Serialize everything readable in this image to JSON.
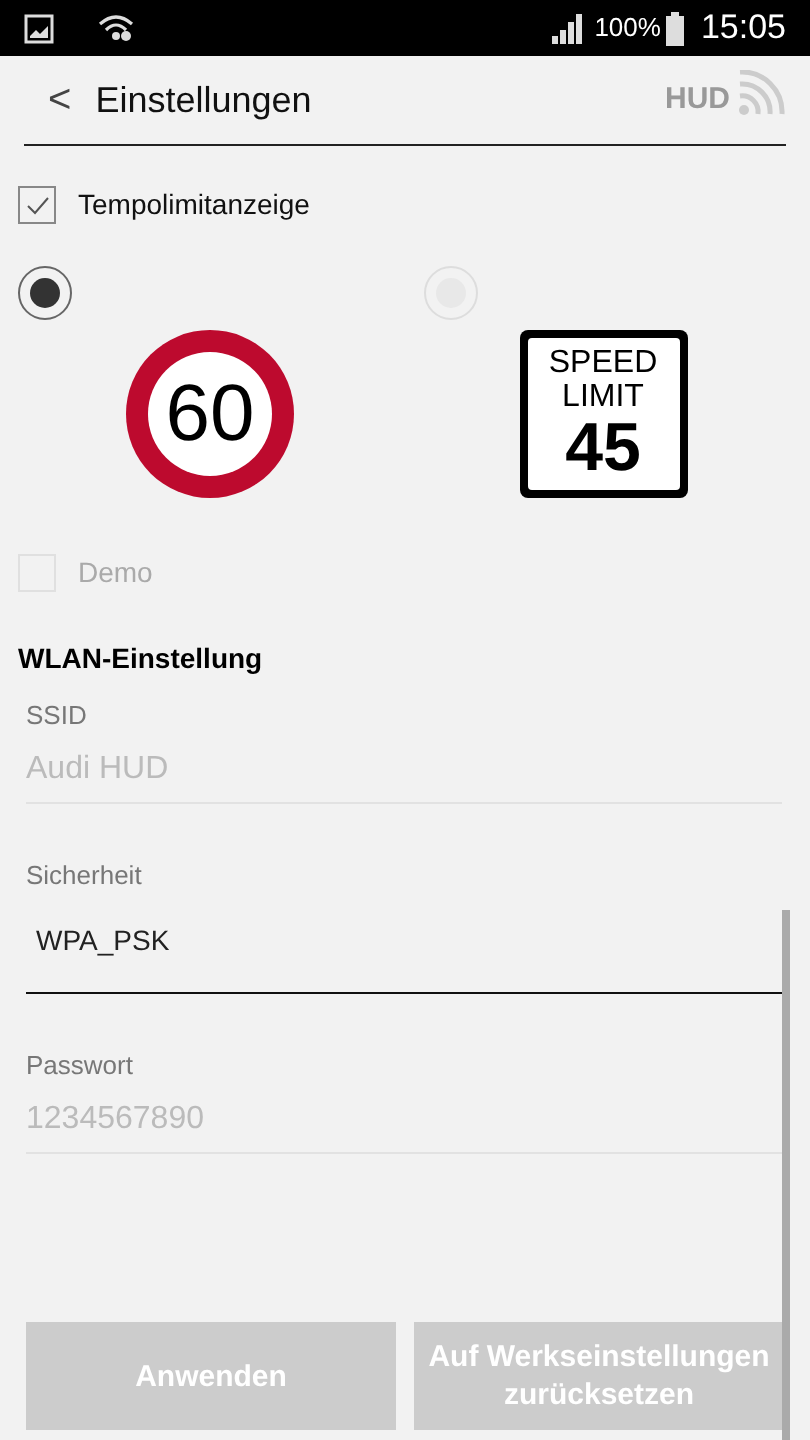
{
  "status_bar": {
    "battery_text": "100%",
    "time": "15:05"
  },
  "header": {
    "back": "<",
    "title": "Einstellungen",
    "logo": "HUD"
  },
  "speed_display": {
    "label": "Tempolimitanzeige",
    "checked": true
  },
  "sign_options": [
    {
      "kind": "round",
      "selected": true,
      "number": "60"
    },
    {
      "kind": "square",
      "selected": false,
      "lines": [
        "SPEED",
        "LIMIT"
      ],
      "number": "45"
    }
  ],
  "demo": {
    "label": "Demo",
    "checked": false,
    "disabled": true
  },
  "wlan": {
    "heading": "WLAN-Einstellung",
    "fields": [
      {
        "label": "SSID",
        "value": "Audi HUD",
        "disabled": true
      },
      {
        "label": "Sicherheit",
        "value": "WPA_PSK",
        "disabled": false
      },
      {
        "label": "Passwort",
        "value": "1234567890",
        "disabled": true
      }
    ]
  },
  "buttons": [
    "Anwenden",
    "Auf Werkseinstellungen zurücksetzen"
  ]
}
